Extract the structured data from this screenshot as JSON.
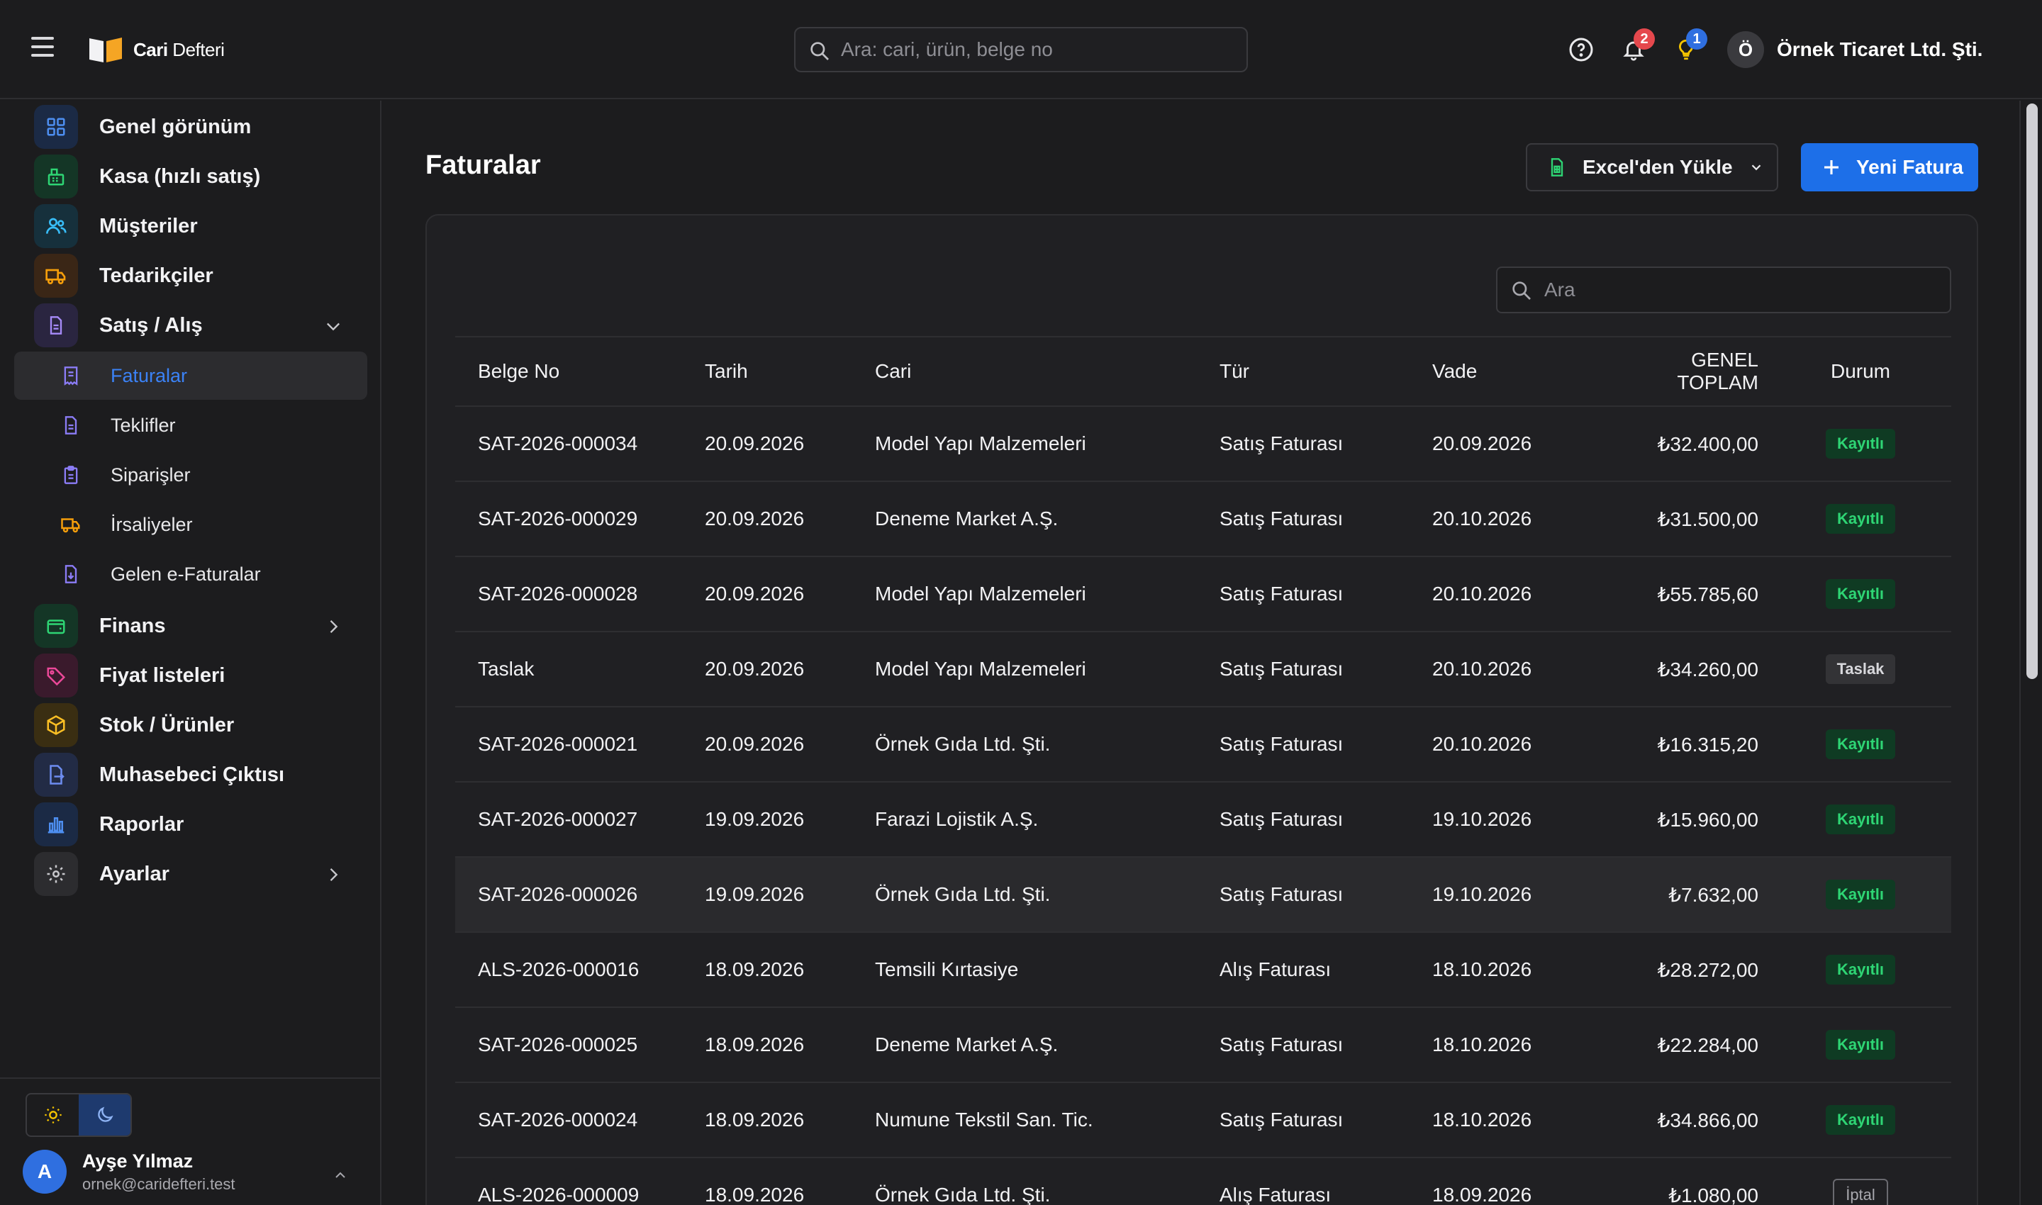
{
  "header": {
    "brand_bold": "Cari",
    "brand_rest": " Defteri",
    "search_placeholder": "Ara: cari, ürün, belge no",
    "notifications_count": "2",
    "tips_count": "1",
    "company_initial": "Ö",
    "company_name": "Örnek Ticaret Ltd. Şti."
  },
  "sidebar": {
    "items": [
      {
        "label": "Genel görünüm",
        "icon": "grid-icon"
      },
      {
        "label": "Kasa (hızlı satış)",
        "icon": "cash-register-icon"
      },
      {
        "label": "Müşteriler",
        "icon": "users-icon"
      },
      {
        "label": "Tedarikçiler",
        "icon": "truck-icon"
      },
      {
        "label": "Satış / Alış",
        "icon": "document-icon"
      },
      {
        "label": "Finans",
        "icon": "wallet-icon"
      },
      {
        "label": "Fiyat listeleri",
        "icon": "tag-icon"
      },
      {
        "label": "Stok / Ürünler",
        "icon": "box-icon"
      },
      {
        "label": "Muhasebeci Çıktısı",
        "icon": "file-export-icon"
      },
      {
        "label": "Raporlar",
        "icon": "bar-chart-icon"
      },
      {
        "label": "Ayarlar",
        "icon": "gear-icon"
      }
    ],
    "subitems": [
      {
        "label": "Faturalar",
        "icon": "receipt-icon",
        "active": true
      },
      {
        "label": "Teklifler",
        "icon": "document-icon"
      },
      {
        "label": "Siparişler",
        "icon": "clipboard-icon"
      },
      {
        "label": "İrsaliyeler",
        "icon": "truck-icon"
      },
      {
        "label": "Gelen e-Faturalar",
        "icon": "file-download-icon"
      }
    ]
  },
  "user": {
    "initial": "A",
    "name": "Ayşe Yılmaz",
    "email": "ornek@caridefteri.test"
  },
  "page": {
    "title": "Faturalar",
    "excel_button": "Excel'den Yükle",
    "new_button": "Yeni Fatura",
    "table_search_placeholder": "Ara"
  },
  "table": {
    "columns": [
      "Belge No",
      "Tarih",
      "Cari",
      "Tür",
      "Vade",
      "GENEL TOPLAM",
      "Durum"
    ],
    "rows": [
      [
        "SAT-2026-000034",
        "20.09.2026",
        "Model Yapı Malzemeleri",
        "Satış Faturası",
        "20.09.2026",
        "₺32.400,00",
        "Kayıtlı"
      ],
      [
        "SAT-2026-000029",
        "20.09.2026",
        "Deneme Market A.Ş.",
        "Satış Faturası",
        "20.10.2026",
        "₺31.500,00",
        "Kayıtlı"
      ],
      [
        "SAT-2026-000028",
        "20.09.2026",
        "Model Yapı Malzemeleri",
        "Satış Faturası",
        "20.10.2026",
        "₺55.785,60",
        "Kayıtlı"
      ],
      [
        "Taslak",
        "20.09.2026",
        "Model Yapı Malzemeleri",
        "Satış Faturası",
        "20.10.2026",
        "₺34.260,00",
        "Taslak"
      ],
      [
        "SAT-2026-000021",
        "20.09.2026",
        "Örnek Gıda Ltd. Şti.",
        "Satış Faturası",
        "20.10.2026",
        "₺16.315,20",
        "Kayıtlı"
      ],
      [
        "SAT-2026-000027",
        "19.09.2026",
        "Farazi Lojistik A.Ş.",
        "Satış Faturası",
        "19.10.2026",
        "₺15.960,00",
        "Kayıtlı"
      ],
      [
        "SAT-2026-000026",
        "19.09.2026",
        "Örnek Gıda Ltd. Şti.",
        "Satış Faturası",
        "19.10.2026",
        "₺7.632,00",
        "Kayıtlı"
      ],
      [
        "ALS-2026-000016",
        "18.09.2026",
        "Temsili Kırtasiye",
        "Alış Faturası",
        "18.10.2026",
        "₺28.272,00",
        "Kayıtlı"
      ],
      [
        "SAT-2026-000025",
        "18.09.2026",
        "Deneme Market A.Ş.",
        "Satış Faturası",
        "18.10.2026",
        "₺22.284,00",
        "Kayıtlı"
      ],
      [
        "SAT-2026-000024",
        "18.09.2026",
        "Numune Tekstil San. Tic.",
        "Satış Faturası",
        "18.10.2026",
        "₺34.866,00",
        "Kayıtlı"
      ],
      [
        "ALS-2026-000009",
        "18.09.2026",
        "Örnek Gıda Ltd. Şti.",
        "Alış Faturası",
        "18.09.2026",
        "₺1.080,00",
        "İptal"
      ]
    ]
  },
  "colors": {
    "accent": "#1d6fe8",
    "status_ok": "#2ed574",
    "background": "#1c1c1e"
  }
}
